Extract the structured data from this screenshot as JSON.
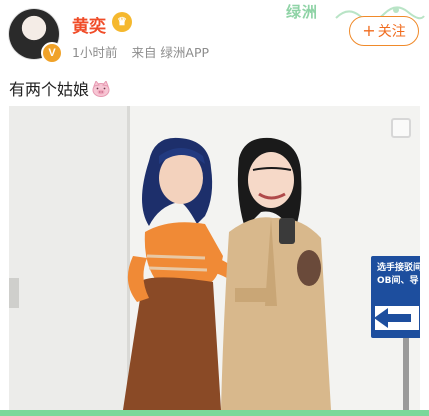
{
  "header": {
    "username": "黄奕",
    "verified_badge": "V",
    "vip_badge": "♛",
    "time": "1小时前",
    "source": "来自 绿洲APP",
    "brand_logo": "绿洲",
    "follow_label": "关注",
    "follow_plus": "+"
  },
  "post": {
    "text": "有两个姑娘",
    "emoji": "pig-face-icon"
  },
  "photo": {
    "sign_text": [
      "选手接驳间",
      "OB间、导"
    ]
  },
  "colors": {
    "username": "#f04c28",
    "follow_border": "#f08a2a",
    "brand_green": "#8fd3a6",
    "meta_gray": "#8d8d8d",
    "sign_blue": "#1d4e9e"
  }
}
